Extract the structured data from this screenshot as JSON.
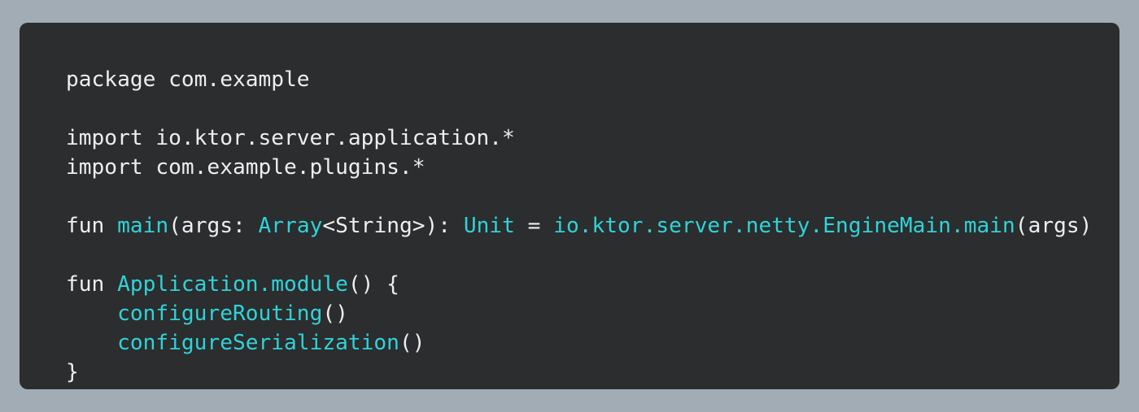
{
  "colors": {
    "page_background": "#a1acb4",
    "editor_background": "#2b2d2e",
    "plain_text": "#eceeef",
    "identifier": "#2fd3d8"
  },
  "code": {
    "language": "kotlin",
    "lines": [
      [
        {
          "text": "package com.example",
          "kind": "plain"
        }
      ],
      [],
      [
        {
          "text": "import io.ktor.server.application.*",
          "kind": "plain"
        }
      ],
      [
        {
          "text": "import com.example.plugins.*",
          "kind": "plain"
        }
      ],
      [],
      [
        {
          "text": "fun ",
          "kind": "plain"
        },
        {
          "text": "main",
          "kind": "ident"
        },
        {
          "text": "(args: ",
          "kind": "plain"
        },
        {
          "text": "Array",
          "kind": "ident"
        },
        {
          "text": "<String>): ",
          "kind": "plain"
        },
        {
          "text": "Unit",
          "kind": "ident"
        },
        {
          "text": " = ",
          "kind": "plain"
        },
        {
          "text": "io.ktor.server.netty.EngineMain.main",
          "kind": "ident"
        },
        {
          "text": "(args)",
          "kind": "plain"
        }
      ],
      [],
      [
        {
          "text": "fun ",
          "kind": "plain"
        },
        {
          "text": "Application.module",
          "kind": "ident"
        },
        {
          "text": "() {",
          "kind": "plain"
        }
      ],
      [
        {
          "text": "    ",
          "kind": "plain"
        },
        {
          "text": "configureRouting",
          "kind": "ident"
        },
        {
          "text": "()",
          "kind": "plain"
        }
      ],
      [
        {
          "text": "    ",
          "kind": "plain"
        },
        {
          "text": "configureSerialization",
          "kind": "ident"
        },
        {
          "text": "()",
          "kind": "plain"
        }
      ],
      [
        {
          "text": "}",
          "kind": "plain"
        }
      ]
    ]
  }
}
